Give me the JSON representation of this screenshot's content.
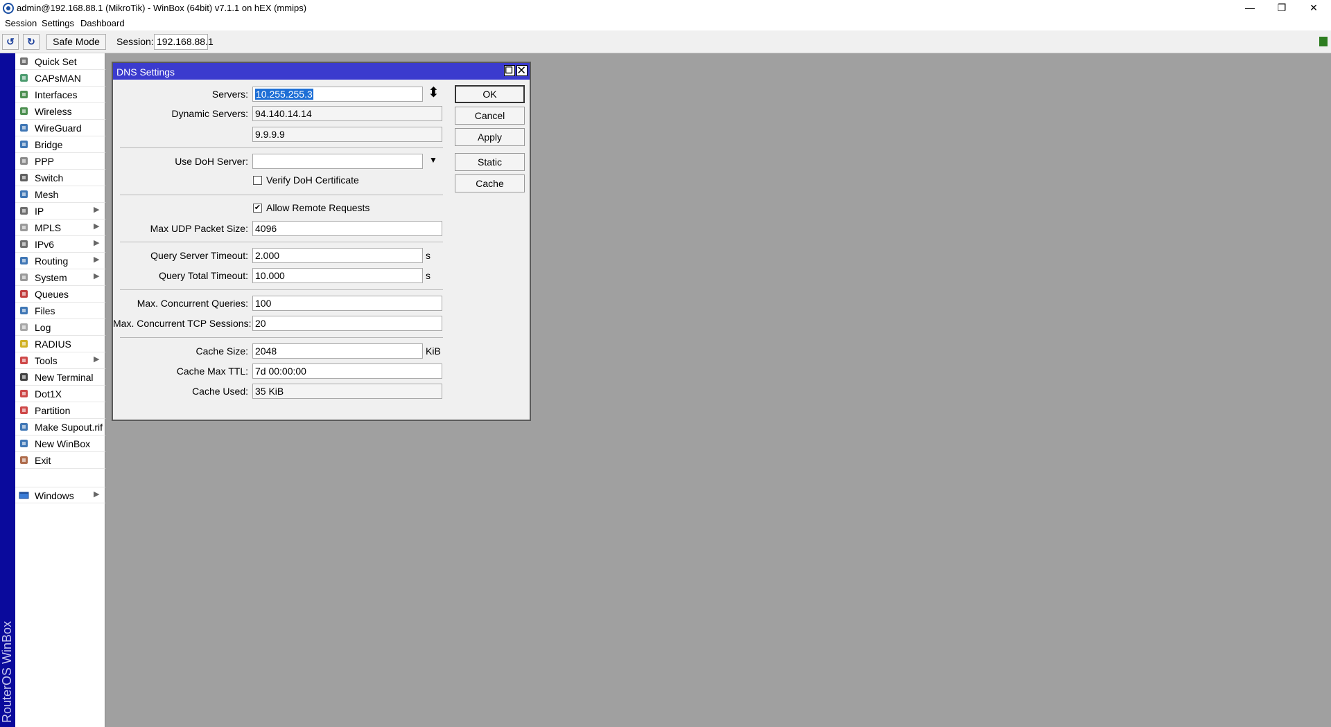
{
  "window": {
    "title": "admin@192.168.88.1 (MikroTik) - WinBox (64bit) v7.1.1 on hEX (mmips)",
    "controls": {
      "minimize": "—",
      "restore": "❐",
      "close": "✕"
    }
  },
  "menubar": [
    "Session",
    "Settings",
    "Dashboard"
  ],
  "toolbar": {
    "undo_icon": "↺",
    "redo_icon": "↻",
    "safe_mode": "Safe Mode",
    "session_label": "Session:",
    "session_value": "192.168.88.1"
  },
  "vertical_brand": "RouterOS WinBox",
  "sidebar": {
    "items": [
      {
        "label": "Quick Set",
        "icon": "quick-set-icon",
        "submenu": false
      },
      {
        "label": "CAPsMAN",
        "icon": "capsman-icon",
        "submenu": false
      },
      {
        "label": "Interfaces",
        "icon": "interfaces-icon",
        "submenu": false
      },
      {
        "label": "Wireless",
        "icon": "wireless-icon",
        "submenu": false
      },
      {
        "label": "WireGuard",
        "icon": "wireguard-icon",
        "submenu": false
      },
      {
        "label": "Bridge",
        "icon": "bridge-icon",
        "submenu": false
      },
      {
        "label": "PPP",
        "icon": "ppp-icon",
        "submenu": false
      },
      {
        "label": "Switch",
        "icon": "switch-icon",
        "submenu": false
      },
      {
        "label": "Mesh",
        "icon": "mesh-icon",
        "submenu": false
      },
      {
        "label": "IP",
        "icon": "ip-icon",
        "submenu": true
      },
      {
        "label": "MPLS",
        "icon": "mpls-icon",
        "submenu": true
      },
      {
        "label": "IPv6",
        "icon": "ipv6-icon",
        "submenu": true
      },
      {
        "label": "Routing",
        "icon": "routing-icon",
        "submenu": true
      },
      {
        "label": "System",
        "icon": "system-icon",
        "submenu": true
      },
      {
        "label": "Queues",
        "icon": "queues-icon",
        "submenu": false
      },
      {
        "label": "Files",
        "icon": "files-icon",
        "submenu": false
      },
      {
        "label": "Log",
        "icon": "log-icon",
        "submenu": false
      },
      {
        "label": "RADIUS",
        "icon": "radius-icon",
        "submenu": false
      },
      {
        "label": "Tools",
        "icon": "tools-icon",
        "submenu": true
      },
      {
        "label": "New Terminal",
        "icon": "terminal-icon",
        "submenu": false
      },
      {
        "label": "Dot1X",
        "icon": "dot1x-icon",
        "submenu": false
      },
      {
        "label": "Partition",
        "icon": "partition-icon",
        "submenu": false
      },
      {
        "label": "Make Supout.rif",
        "icon": "supout-icon",
        "submenu": false
      },
      {
        "label": "New WinBox",
        "icon": "winbox-icon",
        "submenu": false
      },
      {
        "label": "Exit",
        "icon": "exit-icon",
        "submenu": false
      }
    ],
    "windows": {
      "label": "Windows",
      "icon": "windows-icon",
      "submenu": true
    },
    "submenu_arrow": "▶"
  },
  "dns": {
    "title": "DNS Settings",
    "servers_label": "Servers:",
    "servers_value": "10.255.255.3",
    "updown_icon": "⬍",
    "dynamic_label": "Dynamic Servers:",
    "dynamic_1": "94.140.14.14",
    "dynamic_2": "9.9.9.9",
    "doh_label": "Use DoH Server:",
    "doh_value": "",
    "dropdown_icon": "▼",
    "verify_doh_label": "Verify DoH Certificate",
    "verify_doh_checked": false,
    "allow_remote_label": "Allow Remote Requests",
    "allow_remote_checked": true,
    "check_mark": "✔",
    "max_udp_label": "Max UDP Packet Size:",
    "max_udp_value": "4096",
    "qs_timeout_label": "Query Server Timeout:",
    "qs_timeout_value": "2.000",
    "qt_timeout_label": "Query Total Timeout:",
    "qt_timeout_value": "10.000",
    "seconds_unit": "s",
    "max_queries_label": "Max. Concurrent Queries:",
    "max_queries_value": "100",
    "max_tcp_label": "Max. Concurrent TCP Sessions:",
    "max_tcp_value": "20",
    "cache_size_label": "Cache Size:",
    "cache_size_value": "2048",
    "cache_size_unit": "KiB",
    "cache_ttl_label": "Cache Max TTL:",
    "cache_ttl_value": "7d 00:00:00",
    "cache_used_label": "Cache Used:",
    "cache_used_value": "35 KiB",
    "buttons": {
      "ok": "OK",
      "cancel": "Cancel",
      "apply": "Apply",
      "static": "Static",
      "cache": "Cache"
    }
  },
  "colors": {
    "title_blue": "#3b3bce",
    "vertical_strip": "#0a0a9c",
    "desktop": "#a0a0a0",
    "status_green": "#2e7d20"
  }
}
